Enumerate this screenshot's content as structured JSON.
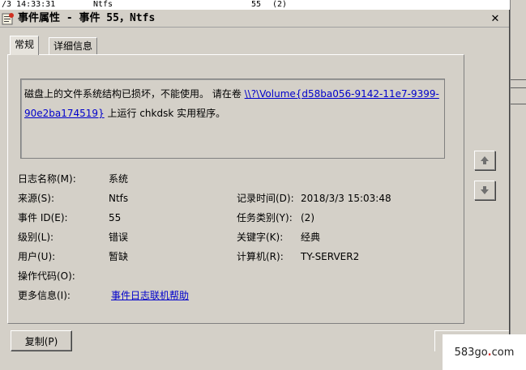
{
  "background": {
    "timestamp": "/3 14:33:31",
    "source": "Ntfs",
    "event_id": "55",
    "category": "(2)"
  },
  "window": {
    "title": "事件属性 - 事件 55，Ntfs",
    "close_label": "✕"
  },
  "tabs": [
    {
      "label": "常规"
    },
    {
      "label": "详细信息"
    }
  ],
  "description": {
    "text_before": "磁盘上的文件系统结构已损坏，不能使用。 请在卷 ",
    "link": "\\\\?\\Volume{d58ba056-9142-11e7-9399-90e2ba174519}",
    "text_after": " 上运行 chkdsk 实用程序。"
  },
  "fields": {
    "log_name_label": "日志名称(M):",
    "log_name": "系统",
    "source_label": "来源(S):",
    "source": "Ntfs",
    "event_id_label": "事件 ID(E):",
    "event_id": "55",
    "level_label": "级别(L):",
    "level": "错误",
    "user_label": "用户(U):",
    "user": "暂缺",
    "opcode_label": "操作代码(O):",
    "opcode": "",
    "more_info_label": "更多信息(I):",
    "more_info_link": "事件日志联机帮助",
    "logged_label": "记录时间(D):",
    "logged": "2018/3/3 15:03:48",
    "task_category_label": "任务类别(Y):",
    "task_category": "(2)",
    "keywords_label": "关键字(K):",
    "keywords": "经典",
    "computer_label": "计算机(R):",
    "computer": "TY-SERVER2"
  },
  "buttons": {
    "copy": "复制(P)"
  },
  "watermark": {
    "text_a": "583go",
    "dot": ".",
    "text_b": "com"
  },
  "icons": [
    "event-log-icon",
    "close-icon",
    "arrow-up-icon",
    "arrow-down-icon"
  ]
}
